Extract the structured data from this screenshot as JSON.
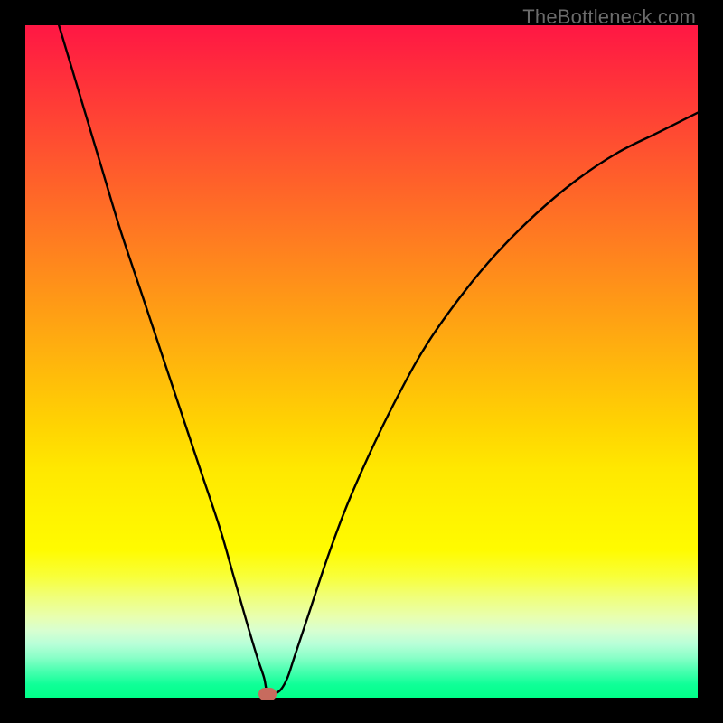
{
  "watermark": "TheBottleneck.com",
  "chart_data": {
    "type": "line",
    "title": "",
    "xlabel": "",
    "ylabel": "",
    "xlim": [
      0,
      100
    ],
    "ylim": [
      0,
      100
    ],
    "grid": false,
    "curve": {
      "x": [
        5,
        8,
        11,
        14,
        17,
        20,
        23,
        26,
        29,
        31,
        33,
        34.5,
        35.5,
        36,
        37,
        38,
        39,
        40,
        42,
        45,
        48,
        52,
        56,
        60,
        65,
        70,
        76,
        82,
        88,
        94,
        100
      ],
      "y": [
        100,
        90,
        80,
        70,
        61,
        52,
        43,
        34,
        25,
        18,
        11,
        6,
        3,
        0.8,
        0.6,
        1.2,
        3.0,
        6.0,
        12,
        21,
        29,
        38,
        46,
        53,
        60,
        66,
        72,
        77,
        81,
        84,
        87
      ]
    },
    "marker": {
      "x": 36,
      "y": 0.5,
      "color": "#c76b5e"
    },
    "background_gradient": {
      "top": "#ff1744",
      "mid": "#ffe800",
      "bottom": "#00ff88"
    }
  }
}
